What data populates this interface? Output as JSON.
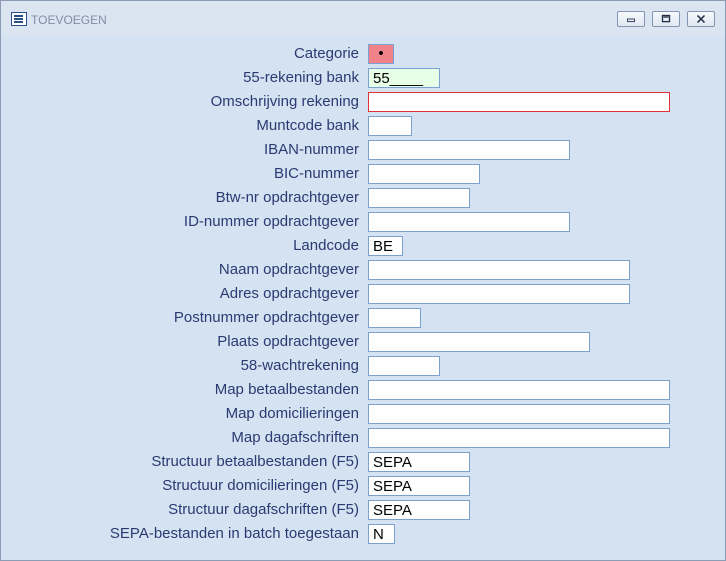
{
  "window": {
    "title": "TOEVOEGEN",
    "icon": "form-icon",
    "controls": [
      "minimize-icon",
      "restore-icon",
      "close-icon"
    ]
  },
  "form": {
    "fields": [
      {
        "label": "Categorie",
        "value": "•"
      },
      {
        "label": "55-rekening bank",
        "value": "55____"
      },
      {
        "label": "Omschrijving rekening",
        "value": ""
      },
      {
        "label": "Muntcode bank",
        "value": ""
      },
      {
        "label": "IBAN-nummer",
        "value": ""
      },
      {
        "label": "BIC-nummer",
        "value": ""
      },
      {
        "label": "Btw-nr opdrachtgever",
        "value": ""
      },
      {
        "label": "ID-nummer opdrachtgever",
        "value": ""
      },
      {
        "label": "Landcode",
        "value": "BE"
      },
      {
        "label": "Naam opdrachtgever",
        "value": ""
      },
      {
        "label": "Adres opdrachtgever",
        "value": ""
      },
      {
        "label": "Postnummer opdrachtgever",
        "value": ""
      },
      {
        "label": "Plaats opdrachtgever",
        "value": ""
      },
      {
        "label": "58-wachtrekening",
        "value": ""
      },
      {
        "label": "Map betaalbestanden",
        "value": ""
      },
      {
        "label": "Map domicilieringen",
        "value": ""
      },
      {
        "label": "Map dagafschriften",
        "value": ""
      },
      {
        "label": "Structuur betaalbestanden  (F5)",
        "value": "SEPA"
      },
      {
        "label": "Structuur domicilieringen  (F5)",
        "value": "SEPA"
      },
      {
        "label": "Structuur dagafschriften  (F5)",
        "value": "SEPA"
      },
      {
        "label": "SEPA-bestanden in batch toegestaan",
        "value": "N"
      }
    ]
  },
  "colors": {
    "background": "#d5e2f1",
    "label_text": "#2b3a72",
    "field_border": "#7aa1cf",
    "category_fill": "#f1828a",
    "bank_fill": "#e6ffe6",
    "error_border": "#e0303a"
  }
}
